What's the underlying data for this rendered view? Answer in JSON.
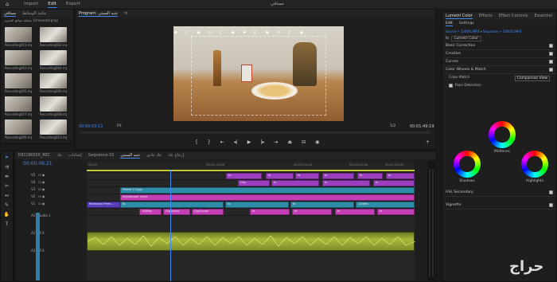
{
  "topnav": {
    "items": [
      "Import",
      "Edit",
      "Export"
    ],
    "active_index": 1,
    "window_title": "مساقي"
  },
  "project": {
    "tabs": [
      "مساقي",
      "مكتبة الوسائط"
    ],
    "search_path": "مشاهد مواقع التصوير (Unnamed.png)",
    "thumbs": [
      "Recording001.mp4",
      "Recording002.mp4",
      "Recording003.mp4",
      "Recording004.mp4",
      "Recording005.mp4",
      "Recording006.mp4",
      "Recording007.mp4",
      "Recording008.mp4",
      "Recording009.mp4",
      "Recording010.mp4"
    ]
  },
  "program": {
    "tabs": [
      "Program: عنبه السبتي",
      "≡"
    ],
    "timecode_left": "00:00:03:11",
    "fit": "Fit",
    "fraction": "1/2",
    "timecode_right": "00:01:49:19"
  },
  "timeline": {
    "tabs": [
      "RECORD00_REC",
      "عاد",
      "إعدادات",
      "Sequence 02",
      "عنبه السبتي",
      "عاد عادي",
      "إرجاع عاد"
    ],
    "active_tab_index": 4,
    "timecode": "00:00:06:21",
    "ruler": [
      "00:00",
      "00:00:15:00",
      "00:00:30:00",
      "00:00:45:00",
      "00:01:00:00"
    ],
    "tracks": [
      {
        "name": "V5",
        "label": ""
      },
      {
        "name": "V4",
        "label": ""
      },
      {
        "name": "V3",
        "label": ""
      },
      {
        "name": "V2",
        "label": ""
      },
      {
        "name": "V1",
        "label": ""
      },
      {
        "name": "A1",
        "label": "Audio 1"
      },
      {
        "name": "A2",
        "label": ""
      },
      {
        "name": "A3",
        "label": ""
      }
    ],
    "clips": {
      "v5": [
        "fx",
        "fx",
        "fx",
        "fx",
        "fx",
        "fx"
      ],
      "v4": [
        "Clip",
        "fx",
        "fx",
        "fx"
      ],
      "v3": [
        "Frame 2 Copy"
      ],
      "v2": [
        "Adjustment Layer"
      ],
      "v1": [
        "Ramadan Prem...",
        "fx",
        "fx",
        "fx",
        "1000fa"
      ],
      "v0": [
        "1000fa",
        "Clip2mp4",
        "Clip2.mp4",
        "fx",
        "fx",
        "fx",
        "fx"
      ]
    }
  },
  "lumetri": {
    "tabs": [
      "Lumetri Color",
      "Effects",
      "Effect Controls",
      "Essential"
    ],
    "subtabs": [
      "Edit",
      "Settings"
    ],
    "source_line": "Source • 1000fa.MP4 ▾ Sequence • 1000fa.MP4",
    "fx_label": "Lumetri Color",
    "sections": [
      "Basic Correction",
      "Creative",
      "Curves",
      "Color Wheels & Match"
    ],
    "color_match": "Color Match",
    "comparison_button": "Comparison View",
    "face_detection": "Face Detection",
    "wheels": [
      "Midtones",
      "Shadows",
      "Highlights"
    ],
    "bottom_sections": [
      "HSL Secondary",
      "Vignette"
    ]
  },
  "watermark": "حراج"
}
